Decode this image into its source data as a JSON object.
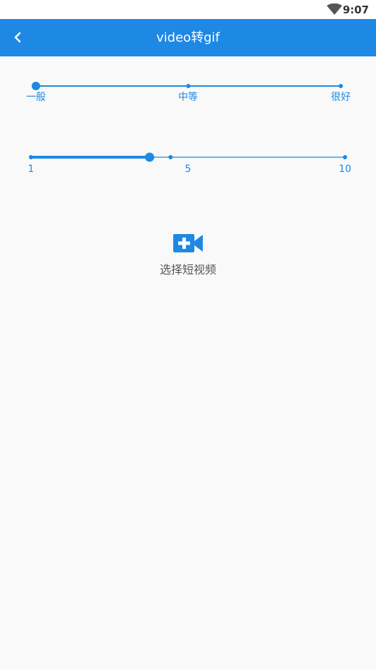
{
  "status_bar": {
    "time": "9:07",
    "wifi_icon": "wifi-icon"
  },
  "toolbar": {
    "back_icon": "chevron-left-icon",
    "title": "video转gif",
    "background_color": "#1e88e5"
  },
  "quality_slider": {
    "ticks": [
      "一般",
      "中等",
      "很好"
    ],
    "selected_index": 0,
    "accent_color": "#1e88e5"
  },
  "fps_slider": {
    "min": 1,
    "max": 10,
    "value": 4.4,
    "tick_values": [
      1,
      5,
      10
    ],
    "tick_labels": [
      "1",
      "5",
      "10"
    ],
    "accent_color": "#1e88e5"
  },
  "pick_video": {
    "icon": "video-add-icon",
    "label": "选择短视频"
  }
}
